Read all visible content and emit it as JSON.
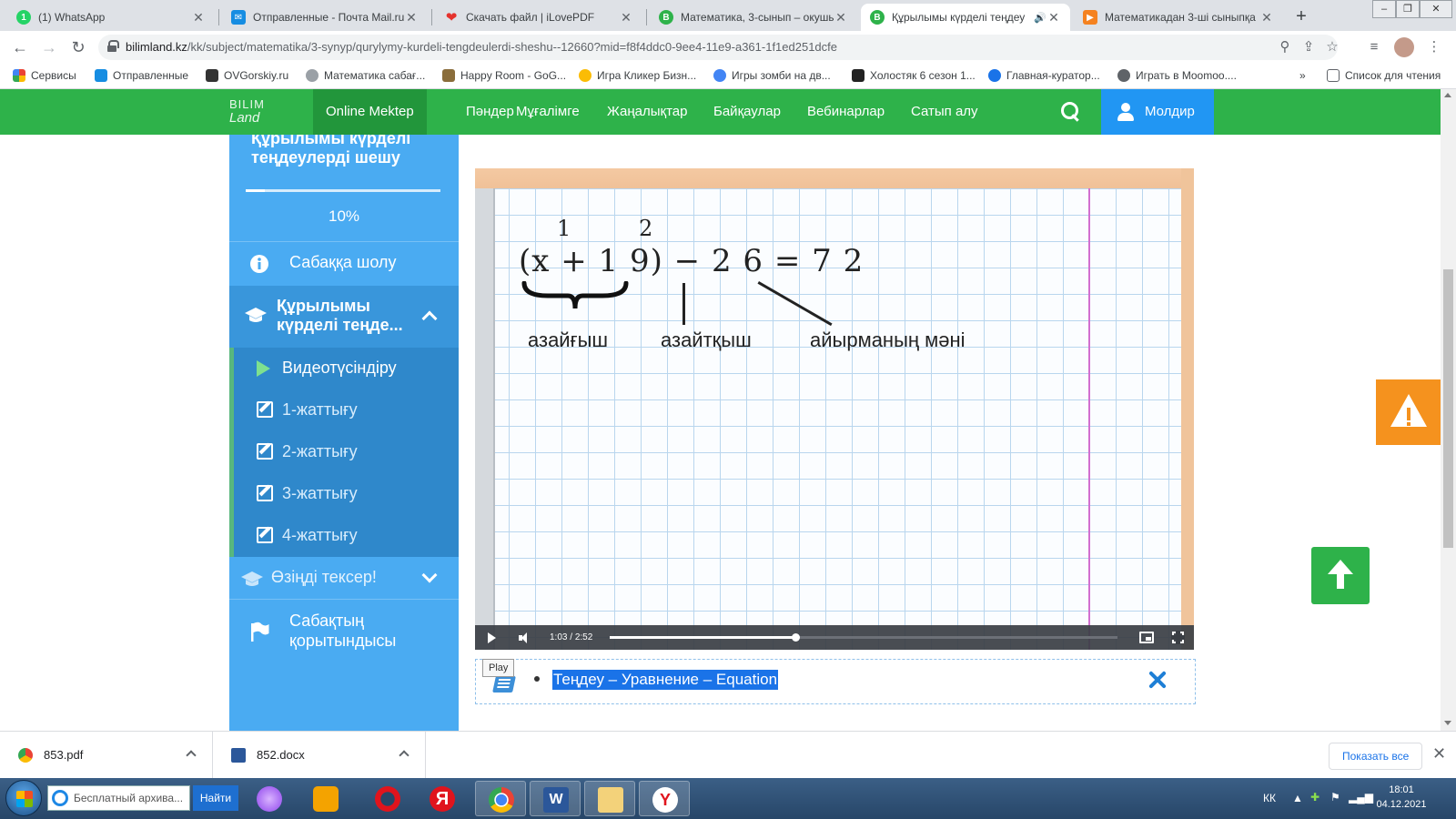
{
  "browser": {
    "tabs": [
      {
        "title": "(1) WhatsApp",
        "icon": "whatsapp-icon",
        "color": "#25d366"
      },
      {
        "title": "Отправленные - Почта Mail.ru",
        "icon": "mail-icon",
        "color": "#168de2"
      },
      {
        "title": "Скачать файл | iLovePDF",
        "icon": "heart-icon",
        "color": "#e5322d"
      },
      {
        "title": "Математика, 3-сынып – окушы",
        "icon": "bilimland-icon",
        "color": "#2eb24a"
      },
      {
        "title": "Құрылымы күрделі теңдеу",
        "icon": "bilimland-icon",
        "color": "#2eb24a"
      },
      {
        "title": "Математикадан 3-ші сыныпқа",
        "icon": "video-icon",
        "color": "#f58220"
      }
    ],
    "url_host": "bilimland.kz",
    "url_rest": "/kk/subject/matematika/3-synyp/qurylymy-kurdeli-tengdeulerdi-sheshu--12660?mid=f8f4ddc0-9ee4-11e9-a361-1f1ed251dcfe",
    "bookmarks": [
      {
        "label": "Сервисы",
        "color": "#ea4335"
      },
      {
        "label": "Отправленные",
        "color": "#168de2"
      },
      {
        "label": "OVGorskiy.ru",
        "color": "#333333"
      },
      {
        "label": "Математика сабағ...",
        "color": "#9aa0a6"
      },
      {
        "label": "Happy Room - GoG...",
        "color": "#8a6d3b"
      },
      {
        "label": "Игра Кликер Бизн...",
        "color": "#fbbc05"
      },
      {
        "label": "Игры зомби на дв...",
        "color": "#4285f4"
      },
      {
        "label": "Холостяк 6 сезон 1...",
        "color": "#222222"
      },
      {
        "label": "Главная-куратор...",
        "color": "#1a73e8"
      },
      {
        "label": "Играть в Moomoo....",
        "color": "#5f6368"
      }
    ],
    "reading_list": "Список для чтения",
    "more": "»"
  },
  "site": {
    "logo_top": "BILIM",
    "logo_bottom": "Land",
    "nav": [
      "Online Mektep",
      "Пәндер",
      "Мұғалімге",
      "Жаңалықтар",
      "Байқаулар",
      "Вебинарлар",
      "Сатып алу"
    ],
    "user": "Молдир"
  },
  "sidebar": {
    "title": "Құрылымы күрделі теңдеулерді шешу",
    "progress_pct": 10,
    "progress_label": "10%",
    "overview": "Сабаққа шолу",
    "section": "Құрылымы күрделі теңде...",
    "items": [
      "Видеотүсіндіру",
      "1-жаттығу",
      "2-жаттығу",
      "3-жаттығу",
      "4-жаттығу"
    ],
    "self_check": "Өзіңді тексер!",
    "final": "Сабақтың қорытындысы"
  },
  "video": {
    "eq_main": "(x + 1 9) − 2 6 = 7 2",
    "eq_sup1": "1",
    "eq_sup2": "2",
    "label1": "азайғыш",
    "label2": "азайтқыш",
    "label3": "айырманың мәні",
    "time_current": "1:03",
    "time_sep": "/",
    "time_total": "2:52",
    "progress_fraction": 0.366
  },
  "tooltip": "Play",
  "glossary": {
    "text": "Теңдеу – Уравнение – Equation"
  },
  "downloads": [
    {
      "name": "853.pdf"
    },
    {
      "name": "852.docx"
    }
  ],
  "show_all": "Показать все",
  "taskbar": {
    "search_text": "Бесплатный архива...",
    "find": "Найти",
    "lang": "КК",
    "time": "18:01",
    "date": "04.12.2021"
  }
}
